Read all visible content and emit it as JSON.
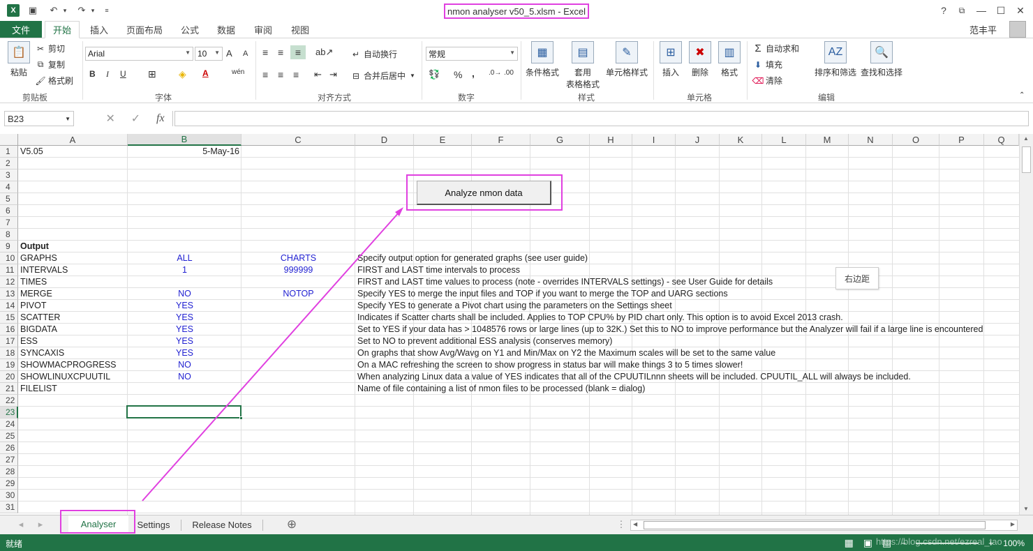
{
  "window": {
    "title": "nmon analyser v50_5.xlsm - Excel",
    "user": "范丰平",
    "help": "?",
    "min": "—",
    "max": "☐",
    "close": "✕",
    "ribbon_opts": "⧉"
  },
  "ribbon_tabs": {
    "file": "文件",
    "items": [
      "开始",
      "插入",
      "页面布局",
      "公式",
      "数据",
      "审阅",
      "视图"
    ]
  },
  "ribbon": {
    "clipboard": {
      "paste": "粘贴",
      "cut": "剪切",
      "copy": "复制",
      "format_painter": "格式刷",
      "label": "剪贴板"
    },
    "font": {
      "name": "Arial",
      "size": "10",
      "grow": "A",
      "shrink": "A",
      "bold": "B",
      "italic": "I",
      "underline": "U",
      "border": "⊞",
      "fill": "◈",
      "color": "A",
      "wen": "wén",
      "label": "字体"
    },
    "alignment": {
      "wrap": "自动换行",
      "merge": "合并后居中",
      "label": "对齐方式"
    },
    "number": {
      "format": "常规",
      "percent": "%",
      "comma": ",",
      "label": "数字"
    },
    "styles": {
      "conditional": "条件格式",
      "table1": "套用",
      "table2": "表格格式",
      "cell_styles": "单元格样式",
      "label": "样式"
    },
    "cells": {
      "insert": "插入",
      "delete": "删除",
      "format": "格式",
      "label": "单元格"
    },
    "editing": {
      "autosum": "自动求和",
      "fill": "填充",
      "clear": "清除",
      "sort": "排序和筛选",
      "find": "查找和选择",
      "label": "编辑"
    }
  },
  "formula_bar": {
    "name_box": "B23",
    "fx": "fx",
    "cancel": "✕",
    "enter": "✓",
    "value": ""
  },
  "columns": [
    "A",
    "B",
    "C",
    "D",
    "E",
    "F",
    "G",
    "H",
    "I",
    "J",
    "K",
    "L",
    "M",
    "N",
    "O",
    "P",
    "Q"
  ],
  "rows": [
    "1",
    "2",
    "3",
    "4",
    "5",
    "6",
    "7",
    "8",
    "9",
    "10",
    "11",
    "12",
    "13",
    "14",
    "15",
    "16",
    "17",
    "18",
    "19",
    "20",
    "21",
    "22",
    "23",
    "24",
    "25",
    "26",
    "27",
    "28",
    "29",
    "30",
    "31"
  ],
  "cells": {
    "A1": "V5.05",
    "B1": "5-May-16",
    "A9": "Output",
    "A10": "GRAPHS",
    "B10": "ALL",
    "C10": "CHARTS",
    "D10": "Specify output option for generated graphs (see user guide)",
    "A11": "INTERVALS",
    "B11": "1",
    "C11": "999999",
    "D11": "FIRST and LAST time intervals to process",
    "A12": "TIMES",
    "D12": "FIRST and LAST time values to process (note - overrides INTERVALS settings) - see User Guide for details",
    "A13": "MERGE",
    "B13": "NO",
    "C13": "NOTOP",
    "D13": "Specify YES to merge the input files and TOP if you want to merge the TOP and UARG sections",
    "A14": "PIVOT",
    "B14": "YES",
    "D14": "Specify YES to generate a Pivot chart using the parameters on the Settings sheet",
    "A15": "SCATTER",
    "B15": "YES",
    "D15": "Indicates if Scatter charts shall be included.  Applies to TOP CPU% by PID chart only.  This option is to avoid Excel 2013 crash.",
    "A16": "BIGDATA",
    "B16": "YES",
    "D16": "Set to YES if your data has > 1048576 rows or large lines (up to 32K.)  Set this to NO to improve performance but the Analyzer will fail if a large line is encountered",
    "A17": "ESS",
    "B17": "YES",
    "D17": "Set to NO to prevent additional ESS analysis (conserves memory)",
    "A18": "SYNCAXIS",
    "B18": "YES",
    "D18": "On graphs that show Avg/Wavg on Y1 and Min/Max on Y2 the Maximum scales will be set to the same value",
    "A19": "SHOWMACPROGRESS",
    "B19": "NO",
    "D19": "On a MAC refreshing the screen to show progress in status bar will make things 3 to 5 times slower!",
    "A20": "SHOWLINUXCPUUTIL",
    "B20": "NO",
    "D20": "When analyzing Linux data a value of YES indicates that all of the CPUUTILnnn sheets will be included.  CPUUTIL_ALL will always be included.",
    "A21": "FILELIST",
    "D21": "Name of file containing a list of nmon files to be processed (blank = dialog)"
  },
  "macro_button": "Analyze nmon data",
  "margin_tag": "右边距",
  "sheets": {
    "tabs": [
      "Analyser",
      "Settings",
      "Release Notes"
    ],
    "add": "⊕",
    "prev": "◂",
    "next": "▸"
  },
  "status": {
    "ready": "就绪",
    "zoom": "100%",
    "watermark": "https://blog.csdn.net/ezreal_tao"
  },
  "colors": {
    "excel_green": "#217346",
    "highlight": "#e040e0",
    "param_blue": "#1f1fd1"
  }
}
